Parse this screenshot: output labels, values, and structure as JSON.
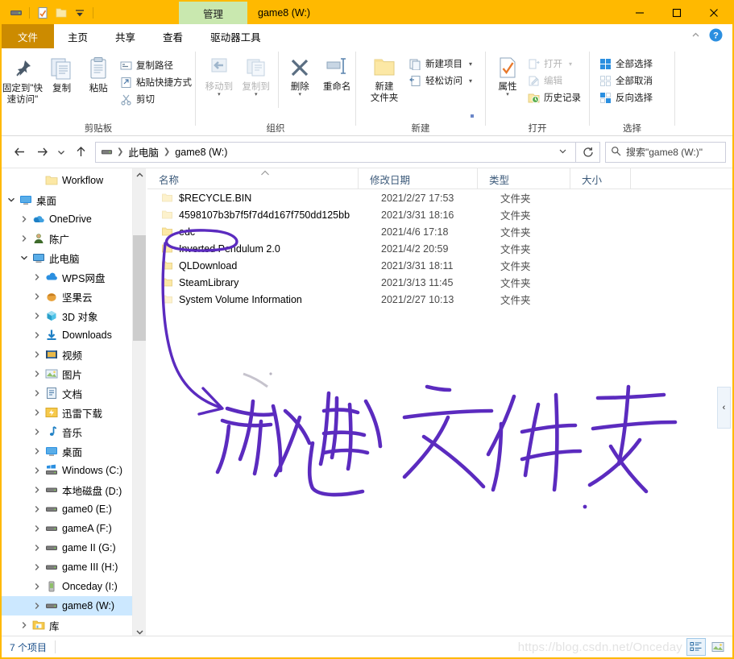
{
  "window": {
    "title": "game8 (W:)",
    "contextual_tab": "管理",
    "controls": {
      "minimize": "—",
      "maximize": "□",
      "close": "✕"
    },
    "quick_access_icons": [
      "drive-icon",
      "properties-icon",
      "new-folder-icon",
      "customize-caret-icon"
    ]
  },
  "tabs": [
    {
      "label": "文件",
      "name": "tab-file"
    },
    {
      "label": "主页",
      "name": "tab-home"
    },
    {
      "label": "共享",
      "name": "tab-share"
    },
    {
      "label": "查看",
      "name": "tab-view"
    },
    {
      "label": "驱动器工具",
      "name": "tab-drive-tools"
    }
  ],
  "ribbon": {
    "groups": [
      {
        "label": "剪贴板",
        "big": [
          {
            "label": "固定到\"快\n速访问\"",
            "icon": "pin-icon"
          },
          {
            "label": "复制",
            "icon": "copy-icon"
          },
          {
            "label": "粘贴",
            "icon": "paste-icon"
          }
        ],
        "small": [
          {
            "label": "复制路径",
            "icon": "copy-path-icon"
          },
          {
            "label": "粘贴快捷方式",
            "icon": "paste-shortcut-icon"
          },
          {
            "label": "剪切",
            "icon": "cut-icon"
          }
        ]
      },
      {
        "label": "组织",
        "big": [
          {
            "label": "移动到",
            "icon": "move-to-icon",
            "dim": true
          },
          {
            "label": "复制到",
            "icon": "copy-to-icon",
            "dim": true
          },
          {
            "label": "删除",
            "icon": "delete-icon"
          },
          {
            "label": "重命名",
            "icon": "rename-icon"
          }
        ]
      },
      {
        "label": "新建",
        "big": [
          {
            "label": "新建\n文件夹",
            "icon": "new-folder-icon"
          }
        ],
        "small": [
          {
            "label": "新建项目",
            "icon": "new-item-icon",
            "caret": true
          },
          {
            "label": "轻松访问",
            "icon": "easy-access-icon",
            "caret": true
          }
        ]
      },
      {
        "label": "打开",
        "big": [
          {
            "label": "属性",
            "icon": "properties-icon"
          }
        ],
        "small": [
          {
            "label": "打开",
            "icon": "open-icon",
            "caret": true,
            "dim": true
          },
          {
            "label": "编辑",
            "icon": "edit-icon",
            "dim": true
          },
          {
            "label": "历史记录",
            "icon": "history-icon"
          }
        ]
      },
      {
        "label": "选择",
        "small": [
          {
            "label": "全部选择",
            "icon": "select-all-icon"
          },
          {
            "label": "全部取消",
            "icon": "select-none-icon"
          },
          {
            "label": "反向选择",
            "icon": "invert-selection-icon"
          }
        ]
      }
    ]
  },
  "addressbar": {
    "back": "←",
    "forward": "→",
    "recent": "⌄",
    "up": "↑",
    "crumbs": [
      "此电脑",
      "game8 (W:)"
    ],
    "refresh": "↻",
    "search_placeholder": "搜索\"game8 (W:)\""
  },
  "navpane": {
    "items": [
      {
        "label": "Workflow",
        "icon": "folder-icon",
        "indent": 2,
        "chev": "",
        "selected": false
      },
      {
        "label": "桌面",
        "icon": "desktop-icon",
        "indent": 0,
        "chev": "open",
        "selected": false
      },
      {
        "label": "OneDrive",
        "icon": "onedrive-icon",
        "indent": 1,
        "chev": "closed",
        "selected": false
      },
      {
        "label": "陈广",
        "icon": "user-icon",
        "indent": 1,
        "chev": "closed",
        "selected": false
      },
      {
        "label": "此电脑",
        "icon": "this-pc-icon",
        "indent": 1,
        "chev": "open",
        "selected": false
      },
      {
        "label": "WPS网盘",
        "icon": "cloud-icon",
        "indent": 2,
        "chev": "closed",
        "selected": false
      },
      {
        "label": "坚果云",
        "icon": "nutstore-icon",
        "indent": 2,
        "chev": "closed",
        "selected": false
      },
      {
        "label": "3D 对象",
        "icon": "3d-objects-icon",
        "indent": 2,
        "chev": "closed",
        "selected": false
      },
      {
        "label": "Downloads",
        "icon": "downloads-icon",
        "indent": 2,
        "chev": "closed",
        "selected": false
      },
      {
        "label": "视频",
        "icon": "videos-icon",
        "indent": 2,
        "chev": "closed",
        "selected": false
      },
      {
        "label": "图片",
        "icon": "pictures-icon",
        "indent": 2,
        "chev": "closed",
        "selected": false
      },
      {
        "label": "文档",
        "icon": "documents-icon",
        "indent": 2,
        "chev": "closed",
        "selected": false
      },
      {
        "label": "迅雷下载",
        "icon": "thunder-download-icon",
        "indent": 2,
        "chev": "closed",
        "selected": false
      },
      {
        "label": "音乐",
        "icon": "music-icon",
        "indent": 2,
        "chev": "closed",
        "selected": false
      },
      {
        "label": "桌面",
        "icon": "desktop-icon",
        "indent": 2,
        "chev": "closed",
        "selected": false
      },
      {
        "label": "Windows (C:)",
        "icon": "windows-drive-icon",
        "indent": 2,
        "chev": "closed",
        "selected": false
      },
      {
        "label": "本地磁盘 (D:)",
        "icon": "drive-icon",
        "indent": 2,
        "chev": "closed",
        "selected": false
      },
      {
        "label": "game0 (E:)",
        "icon": "drive-icon",
        "indent": 2,
        "chev": "closed",
        "selected": false
      },
      {
        "label": "gameA (F:)",
        "icon": "drive-icon",
        "indent": 2,
        "chev": "closed",
        "selected": false
      },
      {
        "label": "game II (G:)",
        "icon": "drive-icon",
        "indent": 2,
        "chev": "closed",
        "selected": false
      },
      {
        "label": "game III (H:)",
        "icon": "drive-icon",
        "indent": 2,
        "chev": "closed",
        "selected": false
      },
      {
        "label": "Onceday (I:)",
        "icon": "usb-drive-icon",
        "indent": 2,
        "chev": "closed",
        "selected": false
      },
      {
        "label": "game8 (W:)",
        "icon": "drive-icon",
        "indent": 2,
        "chev": "closed",
        "selected": true
      },
      {
        "label": "库",
        "icon": "library-icon",
        "indent": 1,
        "chev": "closed",
        "selected": false
      }
    ]
  },
  "filelist": {
    "columns": [
      "名称",
      "修改日期",
      "类型",
      "大小"
    ],
    "sorted_by": "名称",
    "sort_direction": "asc",
    "rows": [
      {
        "name": "$RECYCLE.BIN",
        "date": "2021/2/27 17:53",
        "type": "文件夹",
        "size": "",
        "icon": "folder-icon",
        "faded": true
      },
      {
        "name": "4598107b3b7f5f7d4d167f750dd125bb",
        "date": "2021/3/31 18:16",
        "type": "文件夹",
        "size": "",
        "icon": "folder-icon",
        "faded": true
      },
      {
        "name": "edc",
        "date": "2021/4/6 17:18",
        "type": "文件夹",
        "size": "",
        "icon": "folder-icon",
        "faded": false
      },
      {
        "name": "Inverted Pendulum 2.0",
        "date": "2021/4/2 20:59",
        "type": "文件夹",
        "size": "",
        "icon": "folder-icon",
        "faded": false
      },
      {
        "name": "QLDownload",
        "date": "2021/3/31 18:11",
        "type": "文件夹",
        "size": "",
        "icon": "folder-icon",
        "faded": false
      },
      {
        "name": "SteamLibrary",
        "date": "2021/3/13 11:45",
        "type": "文件夹",
        "size": "",
        "icon": "folder-icon",
        "faded": false
      },
      {
        "name": "System Volume Information",
        "date": "2021/2/27 10:13",
        "type": "文件夹",
        "size": "",
        "icon": "folder-icon",
        "faded": true
      }
    ]
  },
  "statusbar": {
    "item_count": "7 个项目",
    "watermark": "https://blog.csdn.net/Onceday",
    "view_details_icon": "details-view-icon",
    "view_thumbnails_icon": "thumbnails-view-icon"
  },
  "annotation": {
    "handwriting_text": "新建文件夹",
    "ink_color": "#5B2BBF",
    "description": "circle around edc folder with arrow to handwritten label"
  },
  "right_panel_toggle": "‹"
}
